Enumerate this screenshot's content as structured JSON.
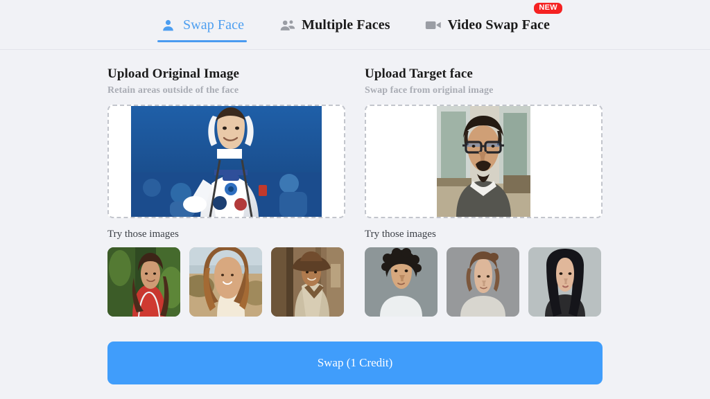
{
  "tabs": [
    {
      "label": "Swap Face",
      "icon": "single-person-icon",
      "active": true,
      "badge": null
    },
    {
      "label": "Multiple Faces",
      "icon": "multiple-people-icon",
      "active": false,
      "badge": null
    },
    {
      "label": "Video Swap Face",
      "icon": "video-camera-icon",
      "active": false,
      "badge": "NEW"
    }
  ],
  "colors": {
    "page_background": "#f1f2f6",
    "accent_blue": "#409dfb",
    "active_tab_blue": "#4c9ef0",
    "badge_red": "#f52222",
    "dropzone_border": "#c2c5cc",
    "subtitle_gray": "#a9acb4"
  },
  "original": {
    "title": "Upload Original Image",
    "subtitle": "Retain areas outside of the face",
    "preview_alt": "astronaut-in-white-spacesuit-blue-background",
    "try_label": "Try those images",
    "thumbs": [
      {
        "alt": "woman-in-red-dress-jungle"
      },
      {
        "alt": "woman-with-flowing-hair-beach"
      },
      {
        "alt": "cowboy-with-hat-western-street"
      }
    ]
  },
  "target": {
    "title": "Upload Target face",
    "subtitle": "Swap face from original image",
    "preview_alt": "man-with-glasses-and-goatee-indoors",
    "try_label": "Try those images",
    "thumbs": [
      {
        "alt": "young-man-with-curly-hair-portrait"
      },
      {
        "alt": "young-woman-with-updo-portrait"
      },
      {
        "alt": "young-woman-with-long-black-hair-portrait"
      }
    ]
  },
  "action": {
    "swap_label": "Swap (1 Credit)"
  }
}
